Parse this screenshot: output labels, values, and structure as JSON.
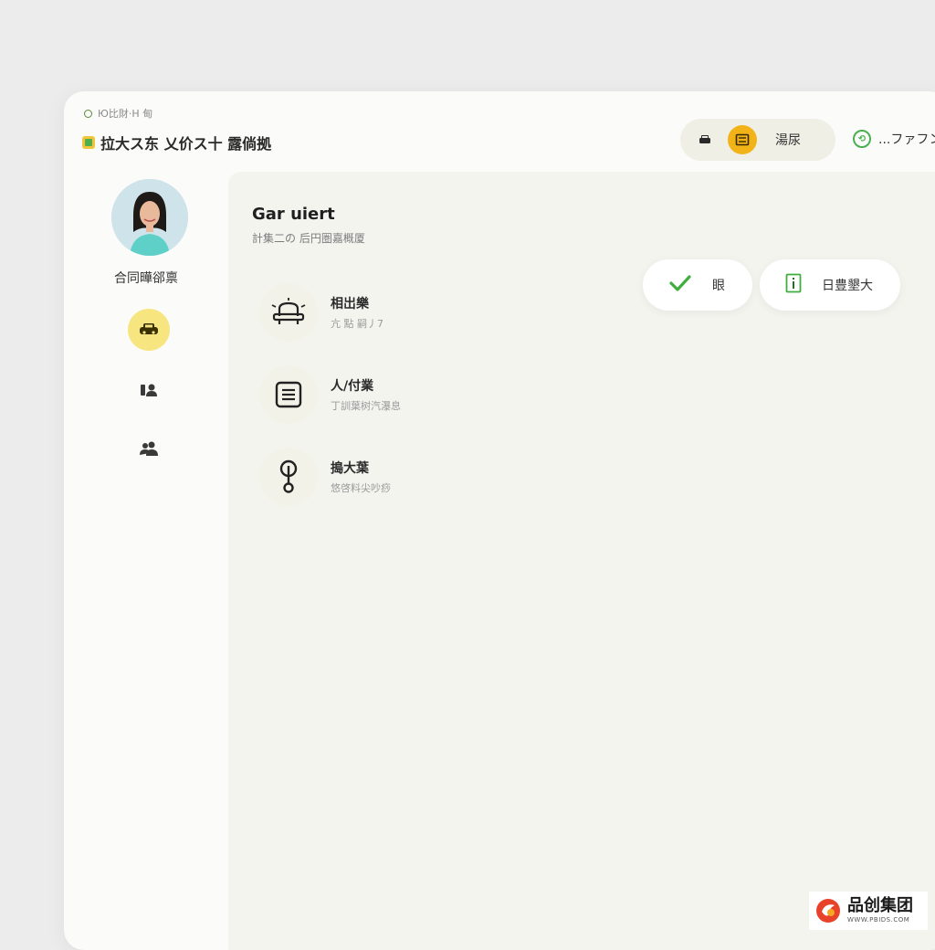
{
  "window": {
    "breadcrumb": "Ю比財·H 甸",
    "app_title": "拉大ス东 乂价ス十 露倘拠"
  },
  "header": {
    "balance_label": "湯尿",
    "status_text": "...ファフン"
  },
  "sidebar": {
    "user_name": "合同曄郤禀",
    "nav_items": [
      {
        "icon": "car-icon",
        "active": true
      },
      {
        "icon": "person-id-icon",
        "active": false
      },
      {
        "icon": "users-icon",
        "active": false
      }
    ]
  },
  "main": {
    "title": "Gar uiert",
    "subtitle": "計集二の 后円圏嘉概厦"
  },
  "actions": {
    "confirm_label": "眼",
    "info_label": "日豊墾大"
  },
  "list": [
    {
      "icon": "vehicle-alert-icon",
      "title": "相岀樂",
      "desc": "亢 點 嗣丿7"
    },
    {
      "icon": "document-list-icon",
      "title": "人/付業",
      "desc": "丁訓葉树汽瀑息"
    },
    {
      "icon": "pin-icon",
      "title": "搗大葉",
      "desc": "悠啓料尖吵痧"
    }
  ],
  "watermark": {
    "name": "品创集团",
    "url": "WWW.PBIDS.COM"
  },
  "colors": {
    "accent_yellow": "#f7e580",
    "coin_orange": "#f2b318",
    "success_green": "#4caf50",
    "window_bg": "#fbfbf9",
    "main_bg": "#f4f4ef"
  }
}
